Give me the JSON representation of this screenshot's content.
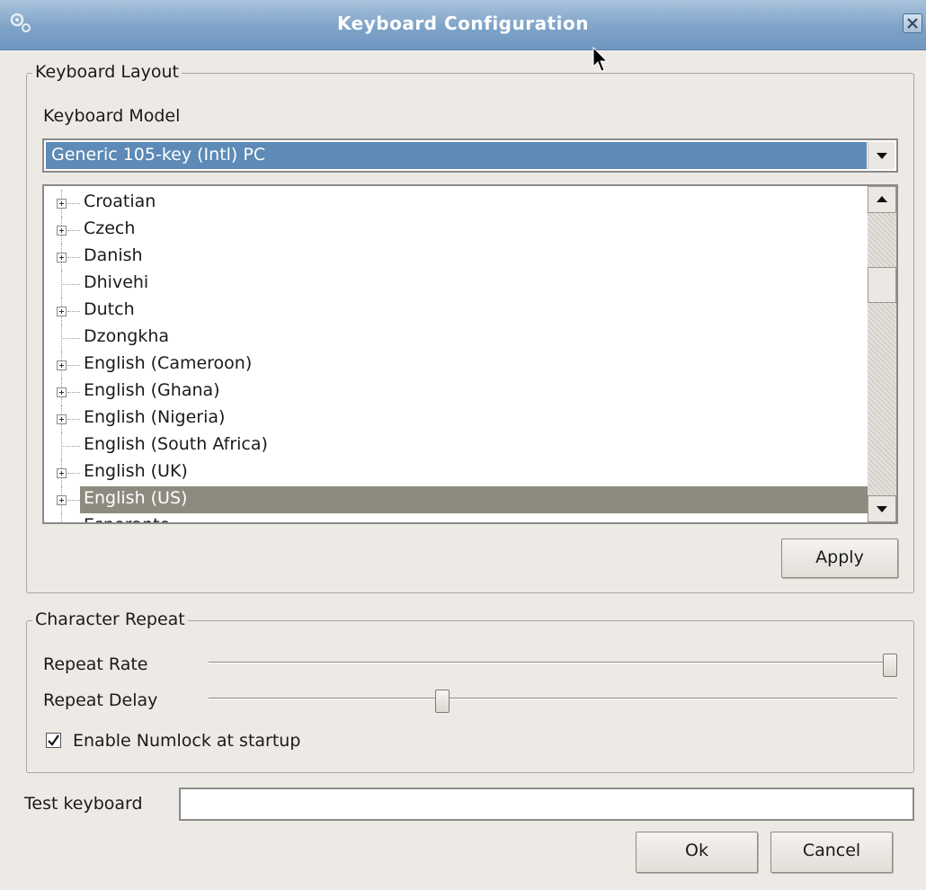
{
  "window": {
    "title": "Keyboard Configuration"
  },
  "layout_group": {
    "title": "Keyboard Layout",
    "model_label": "Keyboard Model",
    "model_value": "Generic 105-key (Intl) PC",
    "tree_items": [
      {
        "label": "Croatian",
        "expandable": true
      },
      {
        "label": "Czech",
        "expandable": true
      },
      {
        "label": "Danish",
        "expandable": true
      },
      {
        "label": "Dhivehi",
        "expandable": false
      },
      {
        "label": "Dutch",
        "expandable": true
      },
      {
        "label": "Dzongkha",
        "expandable": false
      },
      {
        "label": "English (Cameroon)",
        "expandable": true
      },
      {
        "label": "English (Ghana)",
        "expandable": true
      },
      {
        "label": "English (Nigeria)",
        "expandable": true
      },
      {
        "label": "English (South Africa)",
        "expandable": false
      },
      {
        "label": "English (UK)",
        "expandable": true
      },
      {
        "label": "English (US)",
        "expandable": true,
        "selected": true
      },
      {
        "label": "Esperanto",
        "expandable": true
      }
    ],
    "apply_label": "Apply"
  },
  "repeat_group": {
    "title": "Character Repeat",
    "rate_label": "Repeat Rate",
    "rate_value": 1.0,
    "delay_label": "Repeat Delay",
    "delay_value": 0.34,
    "numlock_label": "Enable Numlock at startup",
    "numlock_checked": true
  },
  "test": {
    "label": "Test keyboard",
    "value": ""
  },
  "footer": {
    "ok_label": "Ok",
    "cancel_label": "Cancel"
  },
  "colors": {
    "titlebar": "#7ea3c8",
    "combo_selection": "#5d8ab6",
    "list_selection": "#8f8a7f"
  }
}
